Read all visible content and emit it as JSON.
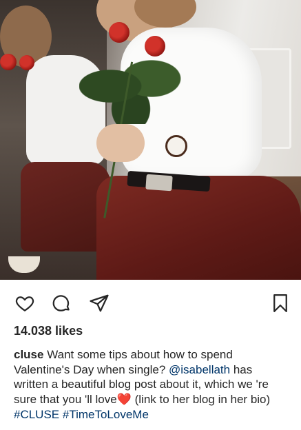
{
  "post": {
    "likes_text": "14.038 likes",
    "caption": {
      "username": "cluse",
      "text_1": " Want some tips about how to spend Valentine's Day when single? ",
      "mention": "@isabellath",
      "text_2": " has written a beautiful blog post about it, which we 're sure that you 'll love",
      "heart": "❤️",
      "text_3": "  (link to her blog in her bio) ",
      "hashtag_1": "#CLUSE",
      "space": " ",
      "hashtag_2": "#TimeToLoveMe"
    }
  },
  "icons": {
    "like": "heart-outline-icon",
    "comment": "comment-bubble-icon",
    "share": "paper-plane-icon",
    "save": "bookmark-icon"
  },
  "colors": {
    "text": "#262626",
    "link": "#003569",
    "heart": "#e11d21"
  }
}
